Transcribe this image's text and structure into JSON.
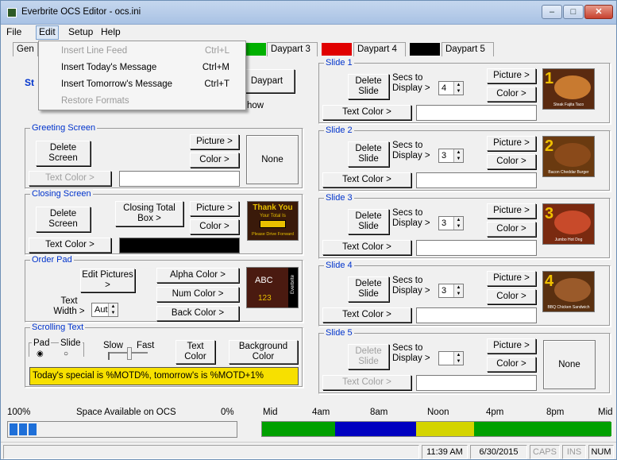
{
  "window": {
    "title": "Everbrite OCS Editor - ocs.ini",
    "min": "–",
    "max": "□",
    "close": "✕"
  },
  "menu": {
    "file": "File",
    "edit": "Edit",
    "setup": "Setup",
    "help": "Help"
  },
  "edit_menu": [
    {
      "label": "Insert Line Feed",
      "shortcut": "Ctrl+L",
      "enabled": false
    },
    {
      "label": "Insert Today's Message",
      "shortcut": "Ctrl+M",
      "enabled": true
    },
    {
      "label": "Insert Tomorrow's Message",
      "shortcut": "Ctrl+T",
      "enabled": true
    },
    {
      "label": "Restore Formats",
      "shortcut": "",
      "enabled": false
    }
  ],
  "tabs": {
    "general": "Gen",
    "daypart3": "Daypart 3",
    "daypart4": "Daypart 4",
    "daypart5": "Daypart 5",
    "daypart_button": "Daypart",
    "show_frag": "how",
    "st_frag": "St"
  },
  "colors": {
    "daypart3": "#00b000",
    "daypart4": "#e00000",
    "daypart5": "#000000"
  },
  "greeting": {
    "title": "Greeting Screen",
    "delete": "Delete Screen",
    "picture": "Picture >",
    "color": "Color >",
    "text_color": "Text Color >",
    "preview": "None"
  },
  "closing": {
    "title": "Closing Screen",
    "delete": "Delete Screen",
    "total_box": "Closing Total Box >",
    "picture": "Picture >",
    "color": "Color >",
    "text_color": "Text Color >",
    "thumb_top": "Thank You",
    "thumb_mid": "Your Total Is",
    "thumb_bot": "Please Drive Forward"
  },
  "order_pad": {
    "title": "Order Pad",
    "edit": "Edit Pictures >",
    "alpha": "Alpha Color >",
    "num": "Num Color >",
    "back": "Back Color >",
    "width_label": "Text Width >",
    "width_value": "Auto",
    "abc": "ABC",
    "num_text": "123",
    "brand": "Everbrite"
  },
  "scrolling": {
    "title": "Scrolling Text",
    "pad_slide_group": "Pad Slide",
    "pad": "Pad",
    "slide": "Slide",
    "slow": "Slow",
    "fast": "Fast",
    "text_color": "Text Color",
    "background": "Background Color",
    "message": "Today's special is %MOTD%, tomorrow's is %MOTD+1%"
  },
  "slides": [
    {
      "title": "Slide 1",
      "delete": "Delete Slide",
      "secs_label": "Secs to Display >",
      "secs": "4",
      "picture": "Picture >",
      "color": "Color >",
      "text_color": "Text Color >",
      "num": "1",
      "caption": "Steak Fajita Taco",
      "disabled": false
    },
    {
      "title": "Slide 2",
      "delete": "Delete Slide",
      "secs_label": "Secs to Display >",
      "secs": "3",
      "picture": "Picture >",
      "color": "Color >",
      "text_color": "Text Color >",
      "num": "2",
      "caption": "Bacon Cheddar Burger",
      "disabled": false
    },
    {
      "title": "Slide 3",
      "delete": "Delete Slide",
      "secs_label": "Secs to Display >",
      "secs": "3",
      "picture": "Picture >",
      "color": "Color >",
      "text_color": "Text Color >",
      "num": "3",
      "caption": "Jumbo Hot Dog",
      "disabled": false
    },
    {
      "title": "Slide 4",
      "delete": "Delete Slide",
      "secs_label": "Secs to Display >",
      "secs": "3",
      "picture": "Picture >",
      "color": "Color >",
      "text_color": "Text Color >",
      "num": "4",
      "caption": "BBQ Chicken Sandwich",
      "disabled": false
    },
    {
      "title": "Slide 5",
      "delete": "Delete Slide",
      "secs_label": "Secs to Display >",
      "secs": "",
      "picture": "Picture >",
      "color": "Color >",
      "text_color": "Text Color >",
      "num": "",
      "caption": "None",
      "disabled": true
    }
  ],
  "space": {
    "left": "100%",
    "label": "Space Available on OCS",
    "right": "0%"
  },
  "timeline": {
    "labels": [
      "Mid",
      "4am",
      "8am",
      "Noon",
      "4pm",
      "8pm",
      "Mid"
    ],
    "colors": [
      "#00a000",
      "#0000c0",
      "#d4d400",
      "#00a000"
    ]
  },
  "statusbar": {
    "time": "11:39 AM",
    "date": "6/30/2015",
    "caps": "CAPS",
    "ins": "INS",
    "num": "NUM"
  }
}
